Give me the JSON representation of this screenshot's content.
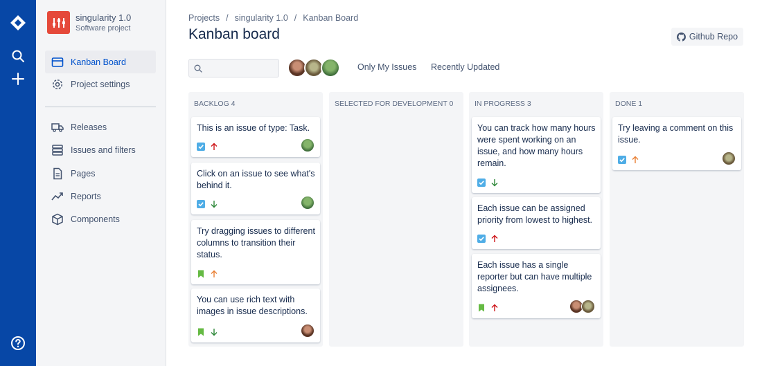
{
  "navbar": {
    "logo_icon": "jira-diamond-icon",
    "search_icon": "search-icon",
    "create_icon": "plus-icon",
    "help_icon": "help-circle-icon",
    "bg_color": "#0747a6"
  },
  "project": {
    "name": "singularity 1.0",
    "type": "Software project",
    "logo_color": "#e5493a"
  },
  "sidebar": {
    "items": [
      {
        "label": "Kanban Board",
        "icon": "board-icon",
        "active": true
      },
      {
        "label": "Project settings",
        "icon": "gear-icon"
      },
      {
        "label": "Releases",
        "icon": "truck-icon"
      },
      {
        "label": "Issues and filters",
        "icon": "stack-icon"
      },
      {
        "label": "Pages",
        "icon": "page-icon"
      },
      {
        "label": "Reports",
        "icon": "trend-icon"
      },
      {
        "label": "Components",
        "icon": "cube-icon"
      }
    ]
  },
  "breadcrumb": [
    "Projects",
    "singularity 1.0",
    "Kanban Board"
  ],
  "page_title": "Kanban board",
  "github_button": "Github Repo",
  "search": {
    "placeholder": "",
    "value": ""
  },
  "filters": {
    "only_my_issues": "Only My Issues",
    "recently_updated": "Recently Updated"
  },
  "columns": [
    {
      "title": "Backlog 4",
      "cards": [
        {
          "text": "This is an issue of type: Task.",
          "type": "task",
          "priority": "high",
          "assignees": 1
        },
        {
          "text": "Click on an issue to see what's behind it.",
          "type": "task",
          "priority": "low",
          "assignees": 1
        },
        {
          "text": "Try dragging issues to different columns to transition their status.",
          "type": "story",
          "priority": "medium",
          "assignees": 0
        },
        {
          "text": "You can use rich text with images in issue descriptions.",
          "type": "story",
          "priority": "low",
          "assignees": 1
        }
      ]
    },
    {
      "title": "Selected for development 0",
      "cards": []
    },
    {
      "title": "In progress 3",
      "cards": [
        {
          "text": "You can track how many hours were spent working on an issue, and how many hours remain.",
          "type": "task",
          "priority": "low",
          "assignees": 0
        },
        {
          "text": "Each issue can be assigned priority from lowest to highest.",
          "type": "task",
          "priority": "high",
          "assignees": 0
        },
        {
          "text": "Each issue has a single reporter but can have multiple assignees.",
          "type": "story",
          "priority": "high",
          "assignees": 2
        }
      ]
    },
    {
      "title": "Done 1",
      "cards": [
        {
          "text": "Try leaving a comment on this issue.",
          "type": "task",
          "priority": "medium",
          "assignees": 1
        }
      ]
    }
  ],
  "colors": {
    "task": "#4fade6",
    "story": "#65ba43",
    "priority_high": "#cd1317",
    "priority_medium": "#e97f33",
    "priority_low": "#2d8738",
    "accent": "#0052cc"
  }
}
